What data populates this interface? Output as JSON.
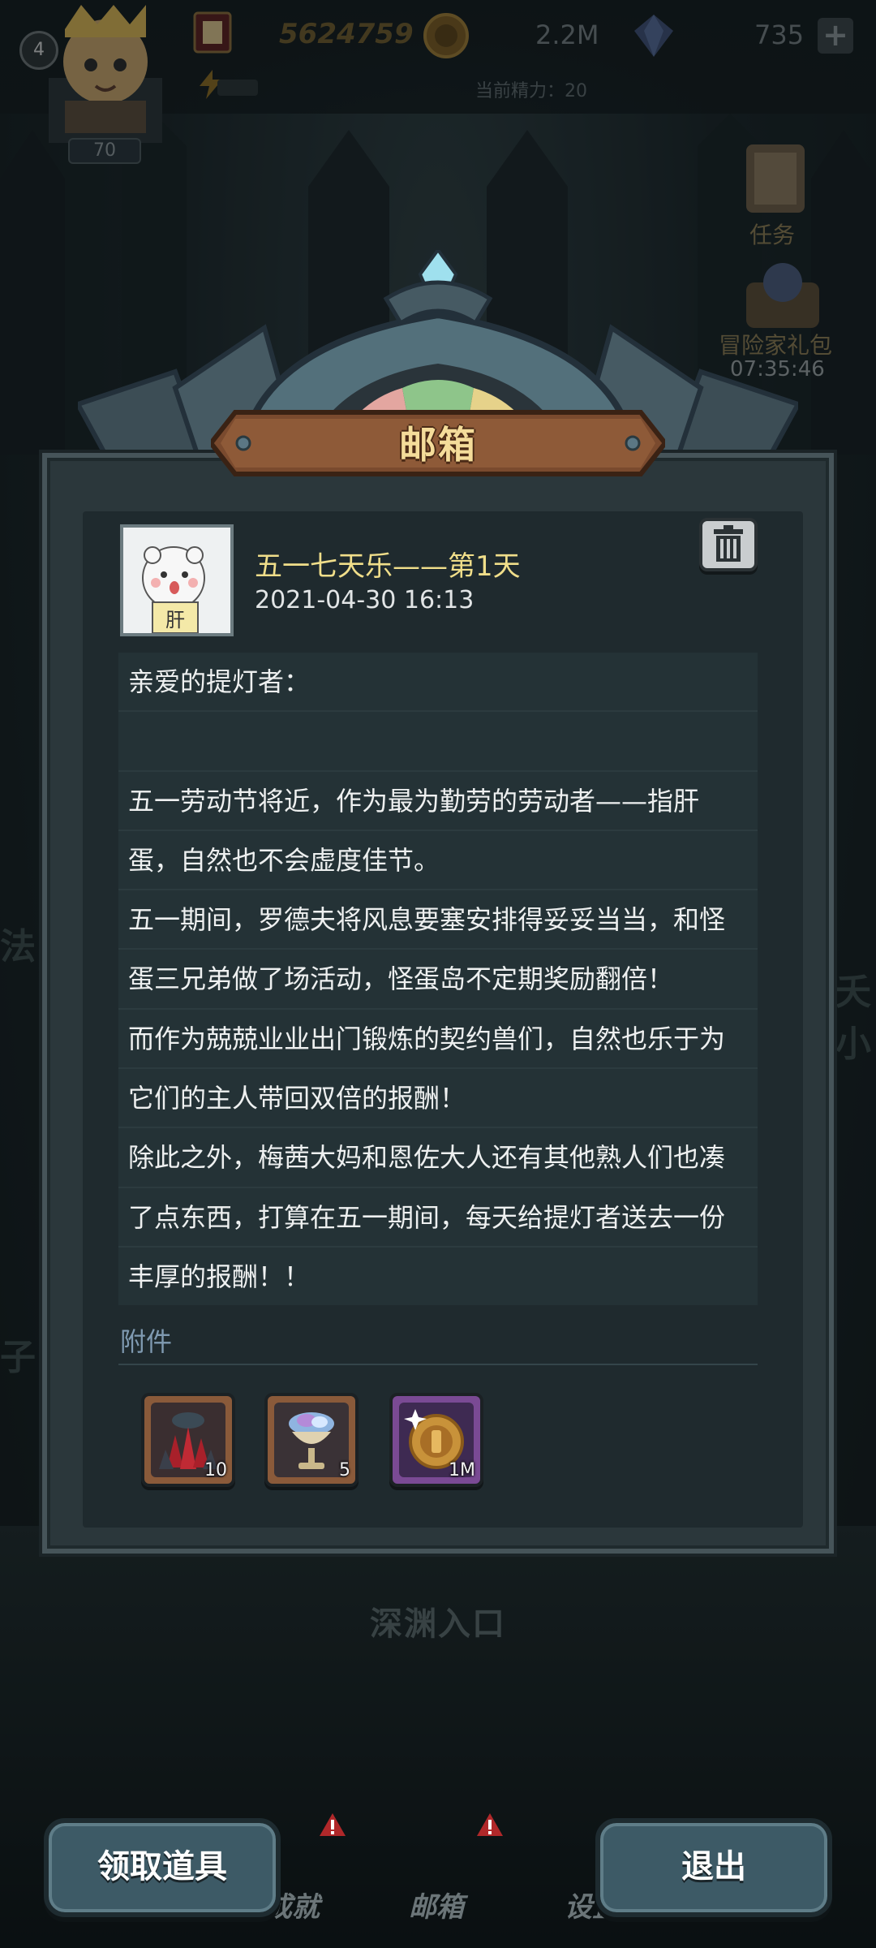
{
  "hud": {
    "level": "4",
    "power": "70",
    "gold": "5624759",
    "coins": "2.2M",
    "gems": "735",
    "plus": "+",
    "energy_text": "当前精力：20"
  },
  "side_menu": {
    "quest_label": "任务",
    "gift_label": "冒险家礼包",
    "gift_timer": "07:35:46"
  },
  "background": {
    "left_label_1": "法",
    "left_label_2": "子",
    "right_label": "夭小",
    "abyss_label": "深渊入口"
  },
  "mailbox": {
    "title": "邮箱",
    "mail_title": "五一七天乐——第1天",
    "mail_date": "2021-04-30 16:13",
    "body_lines": [
      "亲爱的提灯者：",
      "",
      "五一劳动节将近，作为最为勤劳的劳动者——指肝",
      "蛋，自然也不会虚度佳节。",
      "五一期间，罗德夫将风息要塞安排得妥妥当当，和怪",
      "蛋三兄弟做了场活动，怪蛋岛不定期奖励翻倍！",
      "而作为兢兢业业出门锻炼的契约兽们，自然也乐于为",
      "它们的主人带回双倍的报酬！",
      "除此之外，梅茜大妈和恩佐大人还有其他熟人们也凑",
      "了点东西，打算在五一期间，每天给提灯者送去一份",
      "丰厚的报酬！！"
    ],
    "attachments_label": "附件",
    "attachments": [
      {
        "icon": "dark-crystal-cluster-icon",
        "count": "10"
      },
      {
        "icon": "crystal-chalice-icon",
        "count": "5"
      },
      {
        "icon": "gold-coin-icon",
        "count": "1M"
      }
    ],
    "avatar_text": "肝"
  },
  "bottom": {
    "nav_achievements": "成就",
    "nav_mail": "邮箱",
    "nav_settings": "设置",
    "claim_button": "领取道具",
    "exit_button": "退出"
  },
  "colors": {
    "panel": "#2b373b",
    "title_gold": "#f0de8a",
    "attach_blue": "#7f9ab1",
    "button": "#3d5a66"
  }
}
